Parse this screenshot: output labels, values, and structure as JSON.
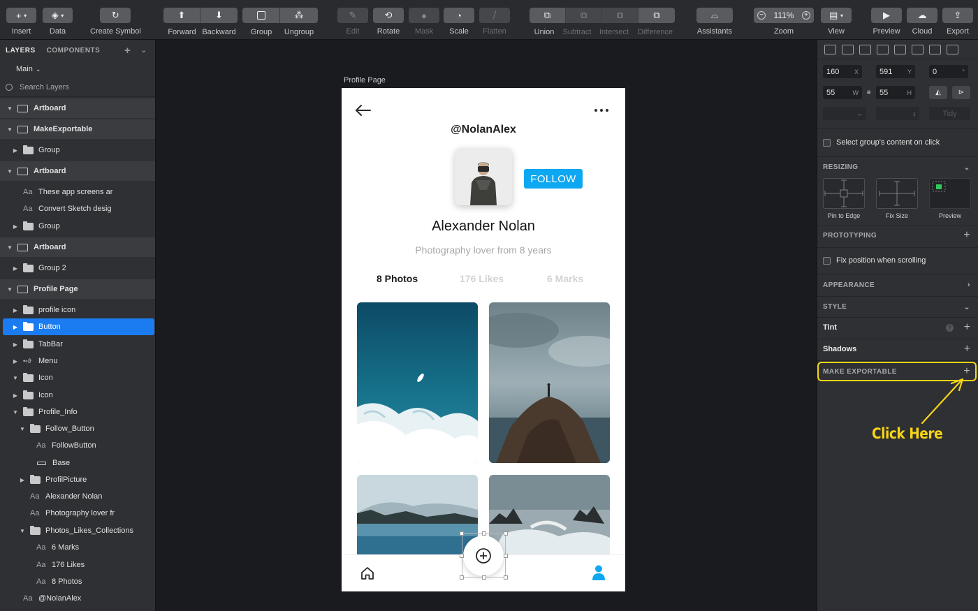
{
  "toolbar": {
    "insert": "Insert",
    "data": "Data",
    "create_symbol": "Create Symbol",
    "forward": "Forward",
    "backward": "Backward",
    "group": "Group",
    "ungroup": "Ungroup",
    "edit": "Edit",
    "rotate": "Rotate",
    "mask": "Mask",
    "scale": "Scale",
    "flatten": "Flatten",
    "union": "Union",
    "subtract": "Subtract",
    "intersect": "Intersect",
    "difference": "Difference",
    "assistants": "Assistants",
    "zoom_label": "Zoom",
    "zoom_value": "111%",
    "zoom_minus": "−",
    "zoom_plus": "+",
    "view": "View",
    "preview": "Preview",
    "cloud": "Cloud",
    "export": "Export"
  },
  "left_panel": {
    "tab_layers": "LAYERS",
    "tab_components": "COMPONENTS",
    "page_selector": "Main",
    "search_placeholder": "Search Layers",
    "layers": [
      {
        "label": "Artboard"
      },
      {
        "label": "MakeExportable"
      },
      {
        "label": "Group"
      },
      {
        "label": "Artboard"
      },
      {
        "label": "These app screens ar"
      },
      {
        "label": "Convert Sketch desig"
      },
      {
        "label": "Group"
      },
      {
        "label": "Artboard"
      },
      {
        "label": "Group 2"
      },
      {
        "label": "Profile Page"
      },
      {
        "label": "profile icon"
      },
      {
        "label": "Button"
      },
      {
        "label": "TabBar"
      },
      {
        "label": "Menu"
      },
      {
        "label": "Icon"
      },
      {
        "label": "Icon"
      },
      {
        "label": "Profile_Info"
      },
      {
        "label": "Follow_Button"
      },
      {
        "label": "FollowButton"
      },
      {
        "label": "Base"
      },
      {
        "label": "ProfilPicture"
      },
      {
        "label": "Alexander Nolan"
      },
      {
        "label": "Photography lover fr"
      },
      {
        "label": "Photos_Likes_Collections"
      },
      {
        "label": "6 Marks"
      },
      {
        "label": "176 Likes"
      },
      {
        "label": "8 Photos"
      },
      {
        "label": "@NolanAlex"
      }
    ]
  },
  "canvas": {
    "artboard_label": "Profile Page",
    "profile": {
      "handle": "@NolanAlex",
      "follow_label": "FOLLOW",
      "name": "Alexander Nolan",
      "bio": "Photography lover from 8 years",
      "stats": {
        "photos": "8 Photos",
        "likes": "176 Likes",
        "marks": "6 Marks"
      }
    }
  },
  "right_panel": {
    "x": "160",
    "x_unit": "X",
    "y": "591",
    "y_unit": "Y",
    "rotation": "0",
    "rotation_unit": "°",
    "w": "55",
    "w_unit": "W",
    "h": "55",
    "h_unit": "H",
    "tidy": "Tidy",
    "select_group_content": "Select group's content on click",
    "resizing": "RESIZING",
    "pin_to_edge": "Pin to Edge",
    "fix_size": "Fix Size",
    "preview": "Preview",
    "prototyping": "PROTOTYPING",
    "fix_position": "Fix position when scrolling",
    "appearance": "APPEARANCE",
    "style": "STYLE",
    "tint": "Tint",
    "tint_help": "?",
    "shadows": "Shadows",
    "make_exportable": "MAKE EXPORTABLE",
    "annotation": "Click Here"
  },
  "colors": {
    "accent_blue": "#1b7cf2",
    "follow_blue": "#0ea7f2",
    "annotation_yellow": "#f7d515"
  }
}
